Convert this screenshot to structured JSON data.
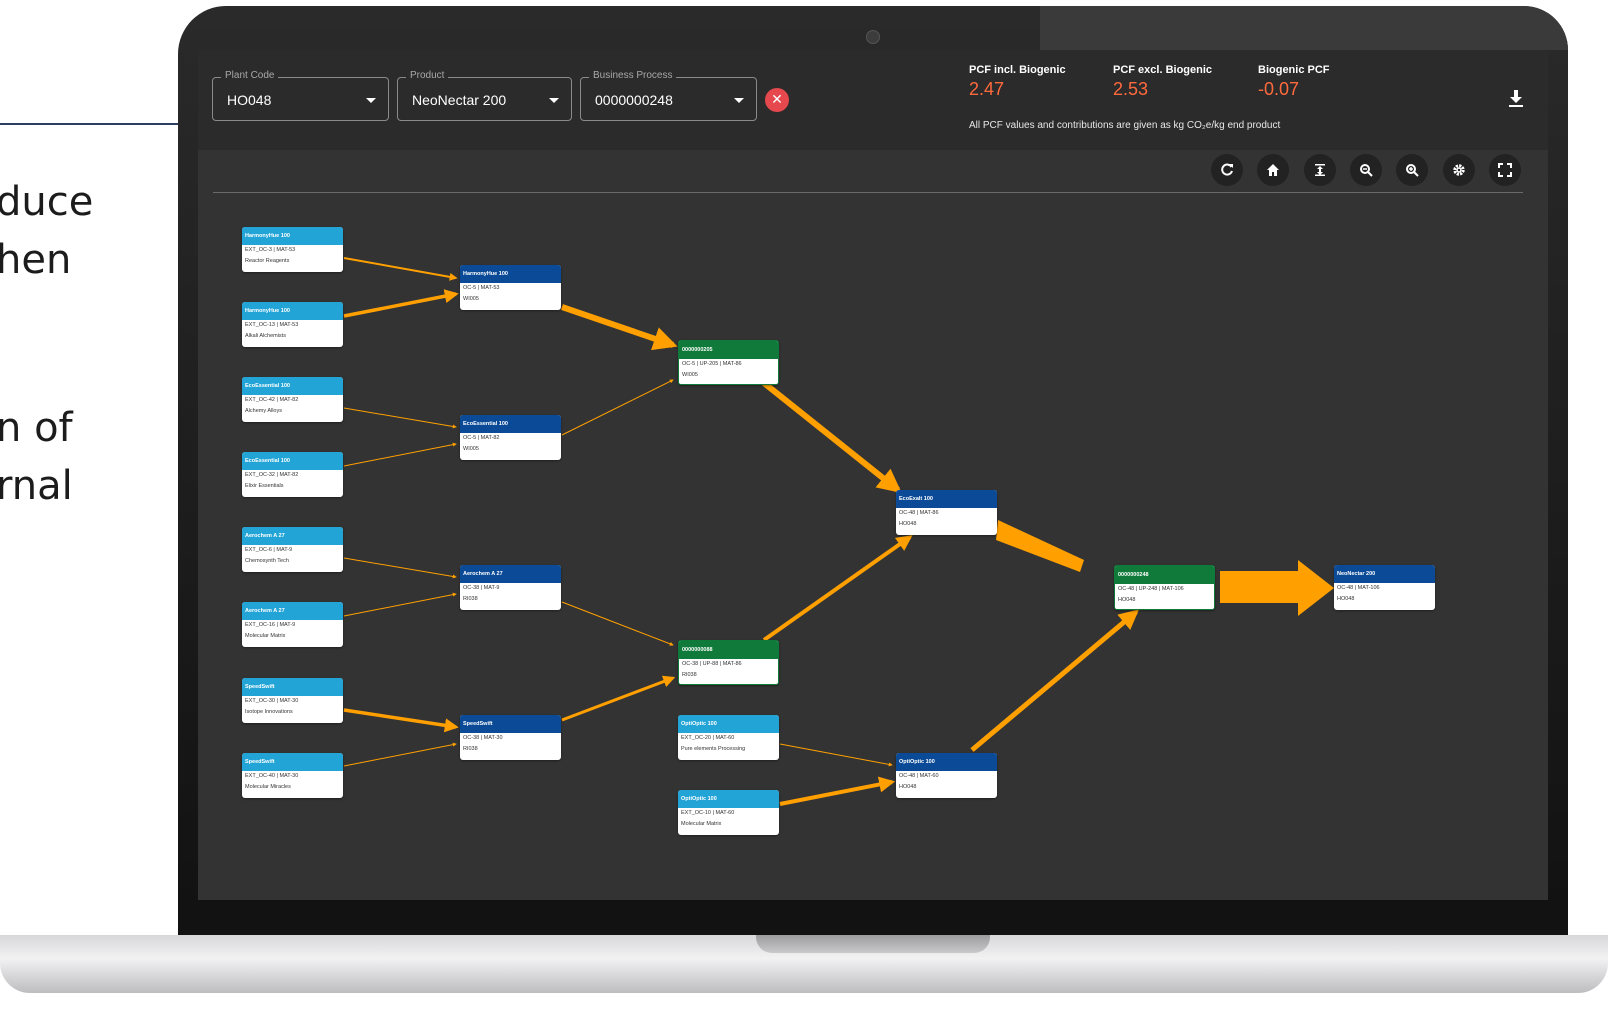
{
  "background_text": [
    "duce",
    "hen",
    "n of",
    "rnal"
  ],
  "filters": [
    {
      "label": "Plant Code",
      "value": "HO048"
    },
    {
      "label": "Product",
      "value": "NeoNectar 200"
    },
    {
      "label": "Business Process",
      "value": "0000000248"
    }
  ],
  "pcf": [
    {
      "title": "PCF incl. Biogenic",
      "value": "2.47"
    },
    {
      "title": "PCF excl. Biogenic",
      "value": "2.53"
    },
    {
      "title": "Biogenic PCF",
      "value": "-0.07"
    }
  ],
  "pcf_note": "All PCF values and contributions are given as kg CO₂e/kg end product",
  "toolbar": [
    "refresh-icon",
    "home-icon",
    "fit-vertical-icon",
    "zoom-out-icon",
    "zoom-in-icon",
    "settings-icon",
    "fullscreen-icon"
  ],
  "colors": {
    "external": "#23a4d7",
    "internal": "#0a4a96",
    "process": "#0f7a3a",
    "flow": "#ffa000",
    "value": "#ff6a3d"
  },
  "nodes": [
    {
      "id": "n1",
      "kind": "ext",
      "title": "HarmonyHue 100",
      "line1": "EXT_OC-3 | MAT-53",
      "line2": "Reactor Reagents"
    },
    {
      "id": "n2",
      "kind": "ext",
      "title": "HarmonyHue 100",
      "line1": "EXT_OC-13 | MAT-53",
      "line2": "Alkali Alchemists"
    },
    {
      "id": "n3",
      "kind": "ext",
      "title": "EcoEssential 100",
      "line1": "EXT_OC-42 | MAT-82",
      "line2": "Alchemy Alloys"
    },
    {
      "id": "n4",
      "kind": "ext",
      "title": "EcoEssential 100",
      "line1": "EXT_OC-32 | MAT-82",
      "line2": "Elixir Essentials"
    },
    {
      "id": "n5",
      "kind": "ext",
      "title": "Aerochem A 27",
      "line1": "EXT_OC-6 | MAT-9",
      "line2": "Chemosynth Tech"
    },
    {
      "id": "n6",
      "kind": "ext",
      "title": "Aerochem A 27",
      "line1": "EXT_OC-16 | MAT-9",
      "line2": "Molecular Matrix"
    },
    {
      "id": "n7",
      "kind": "ext",
      "title": "SpeedSwift",
      "line1": "EXT_OC-30 | MAT-30",
      "line2": "Isotope Innovations"
    },
    {
      "id": "n8",
      "kind": "ext",
      "title": "SpeedSwift",
      "line1": "EXT_OC-40 | MAT-30",
      "line2": "Molecular Miracles"
    },
    {
      "id": "n9",
      "kind": "int",
      "title": "HarmonyHue 100",
      "line1": "OC-5 | MAT-53",
      "line2": "WI005"
    },
    {
      "id": "n10",
      "kind": "int",
      "title": "EcoEssential 100",
      "line1": "OC-5 | MAT-82",
      "line2": "WI005"
    },
    {
      "id": "n11",
      "kind": "int",
      "title": "Aerochem A 27",
      "line1": "OC-38 | MAT-9",
      "line2": "RI038"
    },
    {
      "id": "n12",
      "kind": "int",
      "title": "SpeedSwift",
      "line1": "OC-38 | MAT-30",
      "line2": "RI038"
    },
    {
      "id": "n13",
      "kind": "proc",
      "title": "0000000205",
      "line1": "OC-5 | UP-205 | MAT-86",
      "line2": "WI005"
    },
    {
      "id": "n14",
      "kind": "proc",
      "title": "0000000088",
      "line1": "OC-38 | UP-88 | MAT-86",
      "line2": "RI038"
    },
    {
      "id": "n15",
      "kind": "ext",
      "title": "OptiOptic 100",
      "line1": "EXT_OC-20 | MAT-60",
      "line2": "Pure elements Processing"
    },
    {
      "id": "n16",
      "kind": "ext",
      "title": "OptiOptic 100",
      "line1": "EXT_OC-10 | MAT-60",
      "line2": "Molecular Matrix"
    },
    {
      "id": "n17",
      "kind": "int",
      "title": "EcoExalt 100",
      "line1": "OC-48 | MAT-86",
      "line2": "HO048"
    },
    {
      "id": "n18",
      "kind": "int",
      "title": "OptiOptic 100",
      "line1": "OC-48 | MAT-60",
      "line2": "HO048"
    },
    {
      "id": "n19",
      "kind": "proc",
      "title": "0000000248",
      "line1": "OC-48 | UP-248 | MAT-106",
      "line2": "HO048"
    },
    {
      "id": "n20",
      "kind": "int",
      "title": "NeoNectar 200",
      "line1": "OC-48 | MAT-106",
      "line2": "HO048"
    }
  ]
}
